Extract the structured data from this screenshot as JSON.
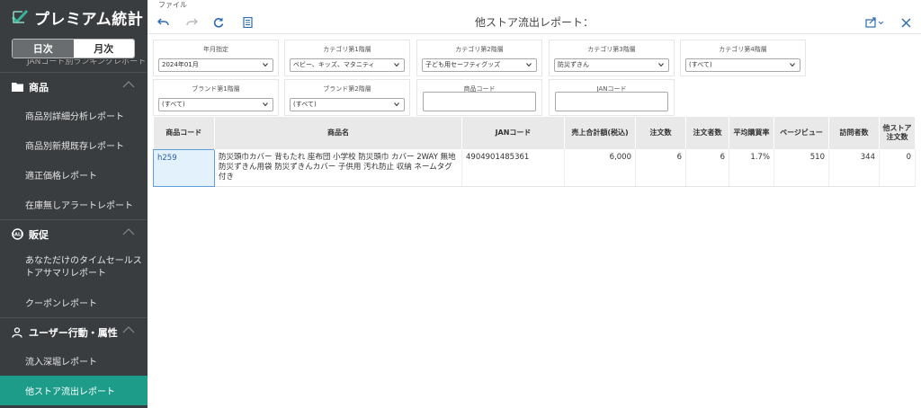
{
  "app": {
    "name": "プレミアム統計"
  },
  "period_toggle": {
    "daily": "日次",
    "monthly": "月次"
  },
  "sidebar": {
    "cut_item": "JANコード別ランキングレポート",
    "sections": [
      {
        "label": "商品",
        "icon": "folder-icon",
        "items": [
          "商品別詳細分析レポート",
          "商品別新規既存レポート",
          "適正価格レポート",
          "在庫無しアラートレポート"
        ]
      },
      {
        "label": "販促",
        "icon": "sale-icon",
        "items": [
          "あなただけのタイムセールストアサマリレポート",
          "クーポンレポート"
        ]
      },
      {
        "label": "ユーザー行動・属性",
        "icon": "user-icon",
        "items": [
          "流入深堀レポート",
          "他ストア流出レポート"
        ]
      }
    ]
  },
  "menubar": {
    "file": "ファイル"
  },
  "toolbar": {
    "title": "他ストア流出レポート："
  },
  "filters": {
    "month": {
      "label": "年月指定",
      "value": "2024年01月"
    },
    "cat1": {
      "label": "カテゴリ第1階層",
      "value": "ベビー、キッズ、マタニティ"
    },
    "cat2": {
      "label": "カテゴリ第2階層",
      "value": "子ども用セーフティグッズ"
    },
    "cat3": {
      "label": "カテゴリ第3階層",
      "value": "防災ずきん"
    },
    "cat4": {
      "label": "カテゴリ第4階層",
      "value": "(すべて)"
    },
    "brand1": {
      "label": "ブランド第1階層",
      "value": "(すべて)"
    },
    "brand2": {
      "label": "ブランド第2階層",
      "value": "(すべて)"
    },
    "product_code": {
      "label": "商品コード",
      "value": ""
    },
    "jan_code": {
      "label": "JANコード",
      "value": ""
    }
  },
  "table": {
    "headers": [
      "商品コード",
      "商品名",
      "JANコード",
      "売上合計額(税込)",
      "注文数",
      "注文者数",
      "平均購買率",
      "ページビュー",
      "訪問者数",
      "他ストア注文数"
    ],
    "rows": [
      {
        "code": "h259",
        "name": "防災頭巾カバー 背もたれ 座布団 小学校 防災頭巾 カバー 2WAY 無地 防災ずきん用袋 防災ずきんカバー 子供用 汚れ防止 収納 ネームタグ付き",
        "jan": "4904901485361",
        "sales": "6,000",
        "orders": "6",
        "buyers": "6",
        "rate": "1.7%",
        "pv": "510",
        "visitors": "344",
        "other": "0"
      }
    ]
  },
  "colors": {
    "sidebar_bg": "#3a3d40",
    "active": "#1e9c8a",
    "accent": "#2e6bb5"
  }
}
